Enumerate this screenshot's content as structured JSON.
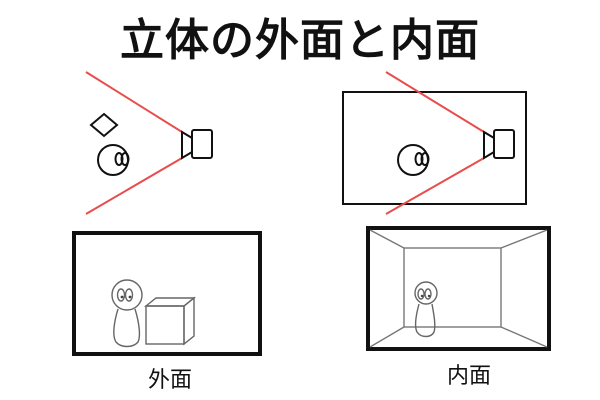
{
  "title": "立体の外面と内面",
  "captions": {
    "outer": "外面",
    "inner": "内面"
  },
  "icons": {
    "camera": "camera-icon",
    "person": "person-head-icon",
    "object": "diamond-object-icon",
    "box": "cube-icon",
    "figure": "person-figure-icon"
  },
  "colors": {
    "view_lines": "#e84c4c",
    "ink": "#111111"
  }
}
